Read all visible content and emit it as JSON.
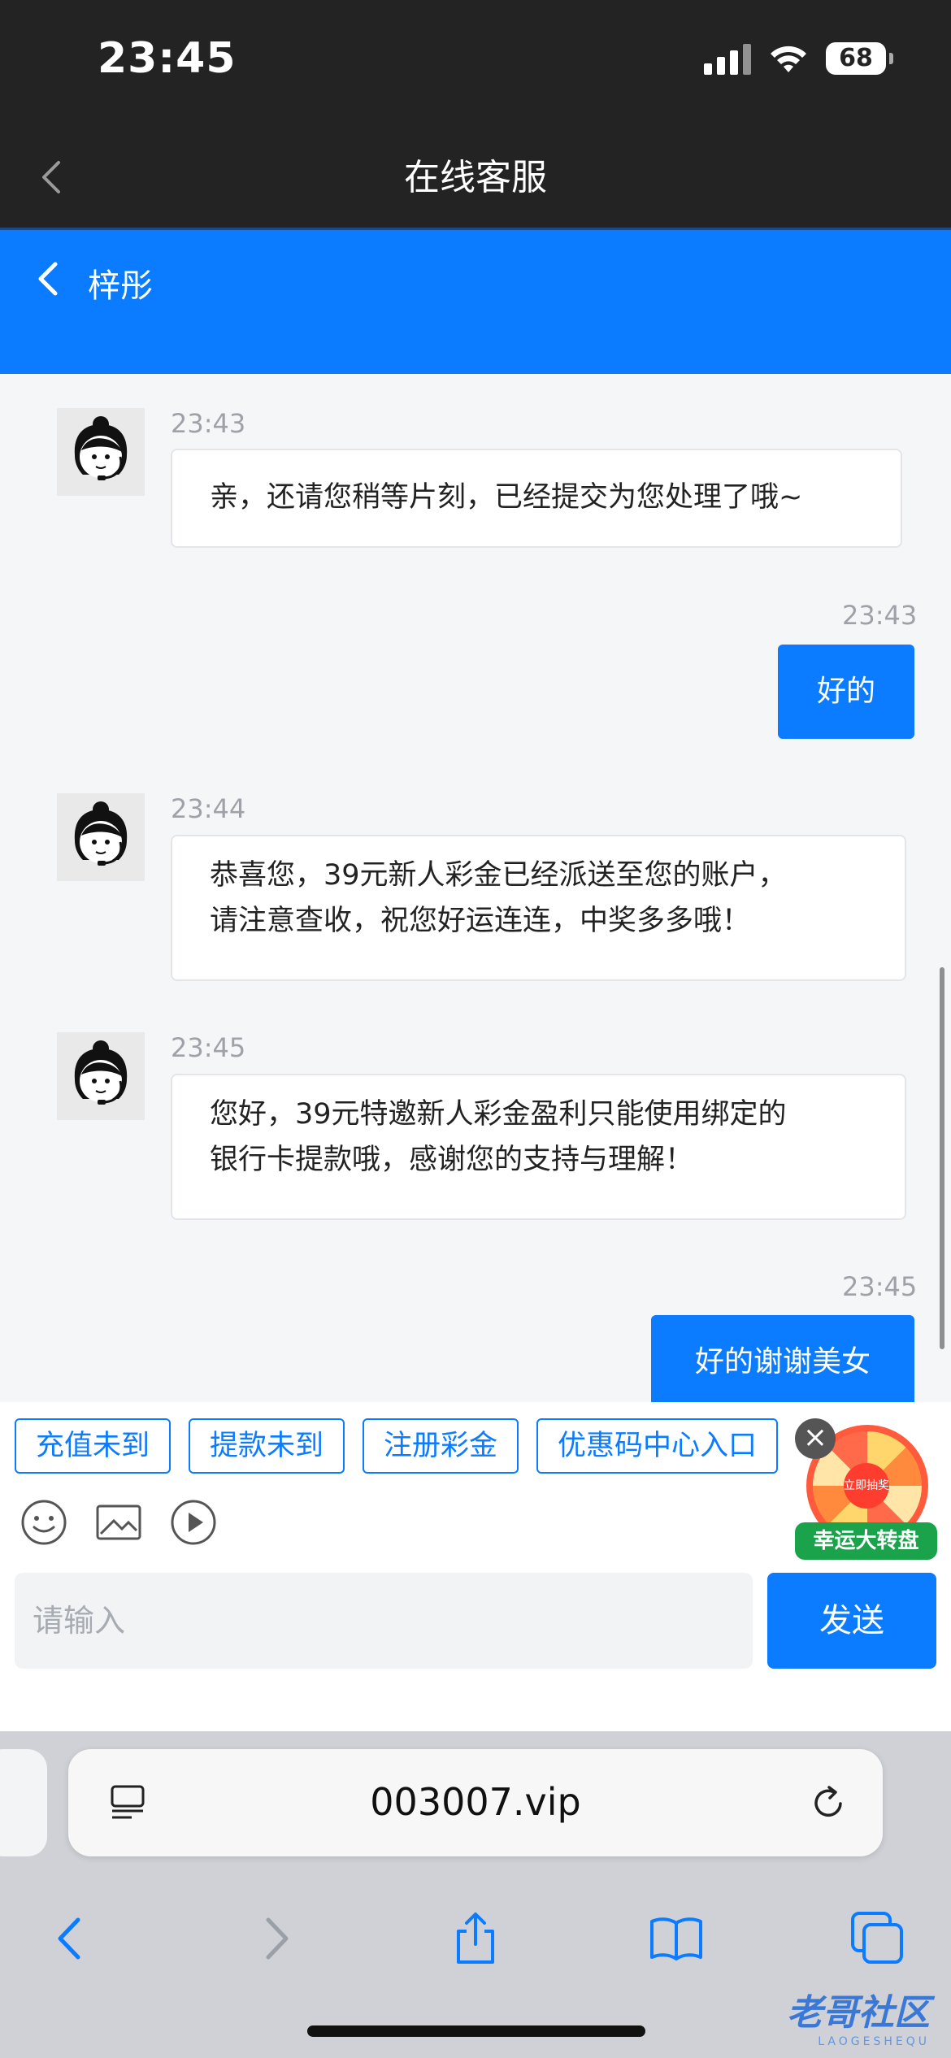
{
  "status_bar": {
    "time": "23:45",
    "battery": "68"
  },
  "title_bar": {
    "title": "在线客服"
  },
  "chat_header": {
    "agent_name": "梓彤"
  },
  "messages": [
    {
      "from": "agent",
      "time": "23:43",
      "lines": [
        "亲，还请您稍等片刻，已经提交为您处理了哦~"
      ]
    },
    {
      "from": "user",
      "time": "23:43",
      "text": "好的"
    },
    {
      "from": "agent",
      "time": "23:44",
      "lines": [
        "恭喜您，39元新人彩金已经派送至您的账户，",
        "请注意查收，祝您好运连连，中奖多多哦！"
      ]
    },
    {
      "from": "agent",
      "time": "23:45",
      "lines": [
        "您好，39元特邀新人彩金盈利只能使用绑定的",
        "银行卡提款哦，感谢您的支持与理解！"
      ]
    },
    {
      "from": "user",
      "time": "23:45",
      "text": "好的谢谢美女"
    }
  ],
  "quick_replies": [
    "充值未到",
    "提款未到",
    "注册彩金",
    "优惠码中心入口"
  ],
  "promo": {
    "center": "立即抽奖",
    "label": "幸运大转盘",
    "close": "×"
  },
  "composer": {
    "placeholder": "请输入",
    "send_label": "发送"
  },
  "browser": {
    "url": "003007.vip"
  },
  "watermark": {
    "text": "老哥社区",
    "sub": "LAOGESHEQU"
  },
  "icons": [
    "back-chevron-icon",
    "emoji-icon",
    "image-icon",
    "video-icon",
    "page-menu-icon",
    "reload-icon",
    "share-icon",
    "bookmarks-icon",
    "tabs-icon"
  ]
}
